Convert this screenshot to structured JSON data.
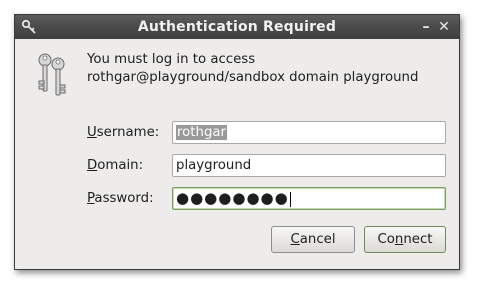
{
  "window": {
    "title": "Authentication Required",
    "minimize_glyph": "–",
    "close_glyph": "✕"
  },
  "message": "You must log in to access rothgar@playground/sandbox domain playground",
  "fields": {
    "username": {
      "label_mnemonic": "U",
      "label_rest": "sername:",
      "value": "rothgar"
    },
    "domain": {
      "label_mnemonic": "D",
      "label_rest": "omain:",
      "value": "playground"
    },
    "password": {
      "label_mnemonic": "P",
      "label_rest": "assword:",
      "value": "●●●●●●●●"
    }
  },
  "buttons": {
    "cancel": {
      "mnemonic": "C",
      "rest": "ancel"
    },
    "connect": {
      "prefix": "Co",
      "mnemonic": "n",
      "rest": "nect"
    }
  },
  "icons": {
    "title_icon": "key-icon",
    "dialog_icon": "keys-icon"
  },
  "colors": {
    "titlebar": "#4a4a4a",
    "window_bg": "#edeceb",
    "selection": "#999999",
    "focus_border": "#7a9e62"
  }
}
